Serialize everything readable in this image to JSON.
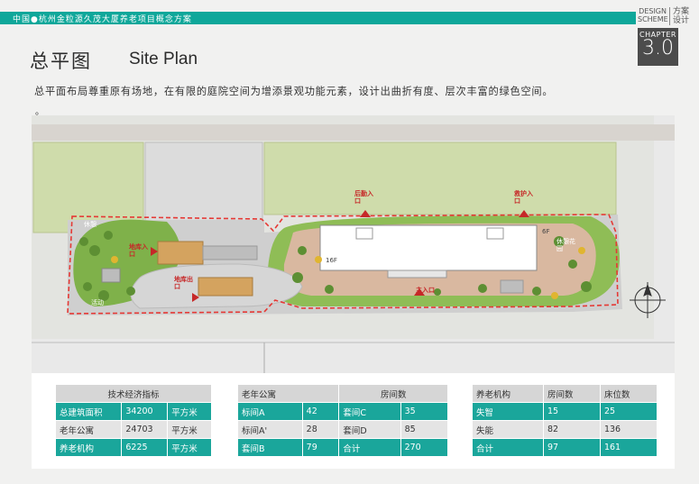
{
  "header": {
    "bar_text": "中国●杭州金粒源久茂大厦养老项目概念方案",
    "design_scheme_en": "DESIGN SCHEME",
    "design_scheme_cn": "方案设计",
    "chapter_label": "CHAPTER",
    "chapter_number": "3.0"
  },
  "title": {
    "cn": "总平图",
    "en": "Site Plan"
  },
  "description": "总平面布局尊重原有场地，在有限的庭院空间为增添景观功能元素，设计出曲折有度、层次丰富的绿色空间。",
  "bullet": "。",
  "colors": {
    "accent": "#1aa69b",
    "route": "#e53935",
    "green": "#8dbf4f"
  },
  "map_labels": {
    "north_entrance_1": "后勤入口",
    "north_entrance_2": "救护入口",
    "west_zone": "休憩",
    "east_zone": "休憩花园",
    "parking_entry": "地库入口",
    "parking_exit": "地库出口",
    "southwest_zone": "活动",
    "main_entrance": "主入口",
    "building_floors_west": "16F",
    "building_floors_east": "6F"
  },
  "table1": {
    "header": "技术经济指标",
    "rows": [
      {
        "name": "总建筑面积",
        "value": "34200",
        "unit": "平方米"
      },
      {
        "name": "老年公寓",
        "value": "24703",
        "unit": "平方米"
      },
      {
        "name": "养老机构",
        "value": "6225",
        "unit": "平方米"
      }
    ]
  },
  "table2": {
    "header_left": "老年公寓",
    "header_right": "房间数",
    "rows": [
      {
        "a": "标间A",
        "b": "42",
        "c": "套间C",
        "d": "35"
      },
      {
        "a": "标间A'",
        "b": "28",
        "c": "套间D",
        "d": "85"
      },
      {
        "a": "套间B",
        "b": "79",
        "c": "合计",
        "d": "270"
      }
    ]
  },
  "table3": {
    "headers": [
      "养老机构",
      "房间数",
      "床位数"
    ],
    "rows": [
      {
        "a": "失智",
        "b": "15",
        "c": "25"
      },
      {
        "a": "失能",
        "b": "82",
        "c": "136"
      },
      {
        "a": "合计",
        "b": "97",
        "c": "161"
      }
    ]
  }
}
